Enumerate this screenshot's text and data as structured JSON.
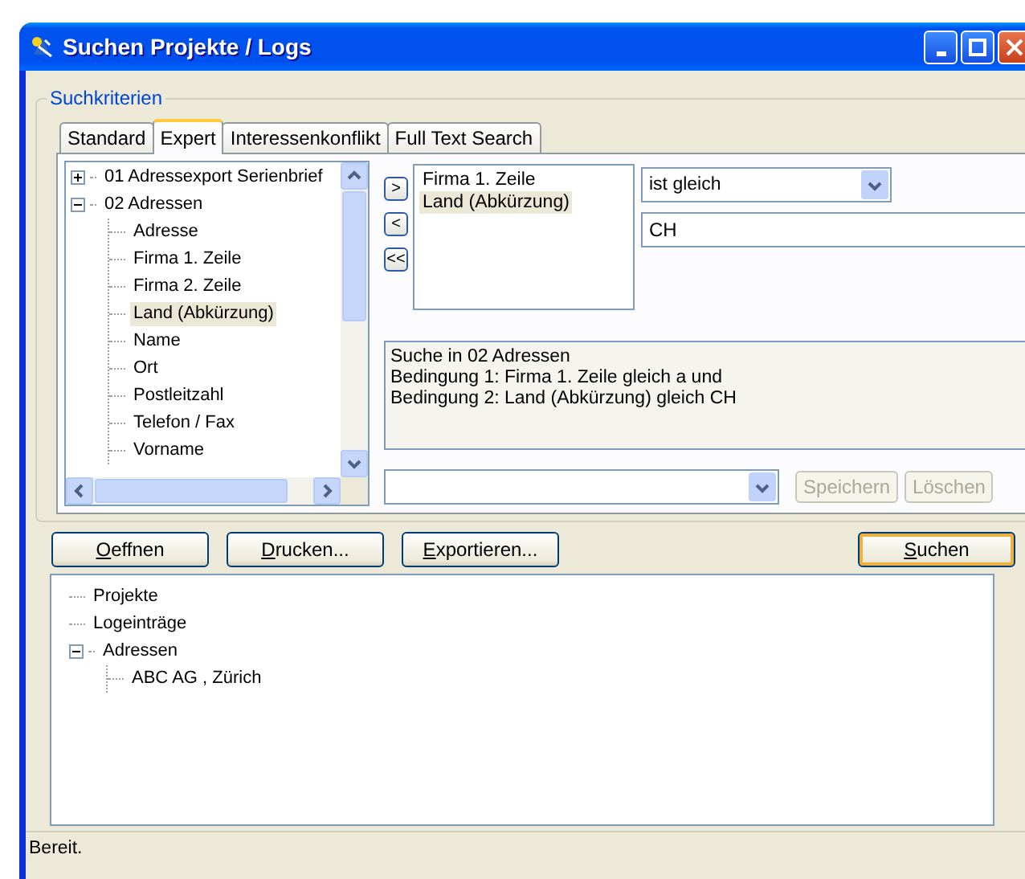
{
  "window": {
    "title": "Suchen Projekte / Logs"
  },
  "criteria": {
    "label": "Suchkriterien",
    "tabs": [
      {
        "label": "Standard",
        "selected": false
      },
      {
        "label": "Expert",
        "selected": true
      },
      {
        "label": "Interessenkonflikt",
        "selected": false
      },
      {
        "label": "Full Text Search",
        "selected": false
      }
    ],
    "field_tree": [
      {
        "label": "01 Adressexport Serienbrief",
        "expanded": false,
        "selected": false
      },
      {
        "label": "02 Adressen",
        "expanded": true,
        "selected": false,
        "children": [
          {
            "label": "Adresse",
            "selected": false
          },
          {
            "label": "Firma 1. Zeile",
            "selected": false
          },
          {
            "label": "Firma 2. Zeile",
            "selected": false
          },
          {
            "label": "Land (Abkürzung)",
            "selected": true
          },
          {
            "label": "Name",
            "selected": false
          },
          {
            "label": "Ort",
            "selected": false
          },
          {
            "label": "Postleitzahl",
            "selected": false
          },
          {
            "label": "Telefon / Fax",
            "selected": false
          },
          {
            "label": "Vorname",
            "selected": false
          }
        ]
      }
    ],
    "move_buttons": [
      ">",
      "<",
      "<<"
    ],
    "chosen_fields": [
      {
        "label": "Firma 1. Zeile",
        "selected": false
      },
      {
        "label": "Land (Abkürzung)",
        "selected": true
      }
    ],
    "operator": {
      "value": "ist gleich"
    },
    "value_field": {
      "value": "CH"
    },
    "summary": [
      "Suche in 02 Adressen",
      "Bedingung 1: Firma 1. Zeile gleich a und",
      "Bedingung 2: Land (Abkürzung) gleich CH"
    ],
    "saved_buttons": [
      {
        "label": "Speichern",
        "disabled": true
      },
      {
        "label": "Löschen",
        "disabled": true
      }
    ]
  },
  "actions": [
    {
      "label": "Oeffnen",
      "default": false
    },
    {
      "label": "Drucken...",
      "default": false
    },
    {
      "label": "Exportieren...",
      "default": false
    },
    {
      "label": "Suchen",
      "default": true
    }
  ],
  "results_tree": [
    {
      "label": "Projekte"
    },
    {
      "label": "Logeinträge"
    },
    {
      "label": "Adressen",
      "expanded": true,
      "children": [
        {
          "label": "ABC AG , Zürich"
        }
      ]
    }
  ],
  "status_bar": {
    "text": "Bereit."
  }
}
